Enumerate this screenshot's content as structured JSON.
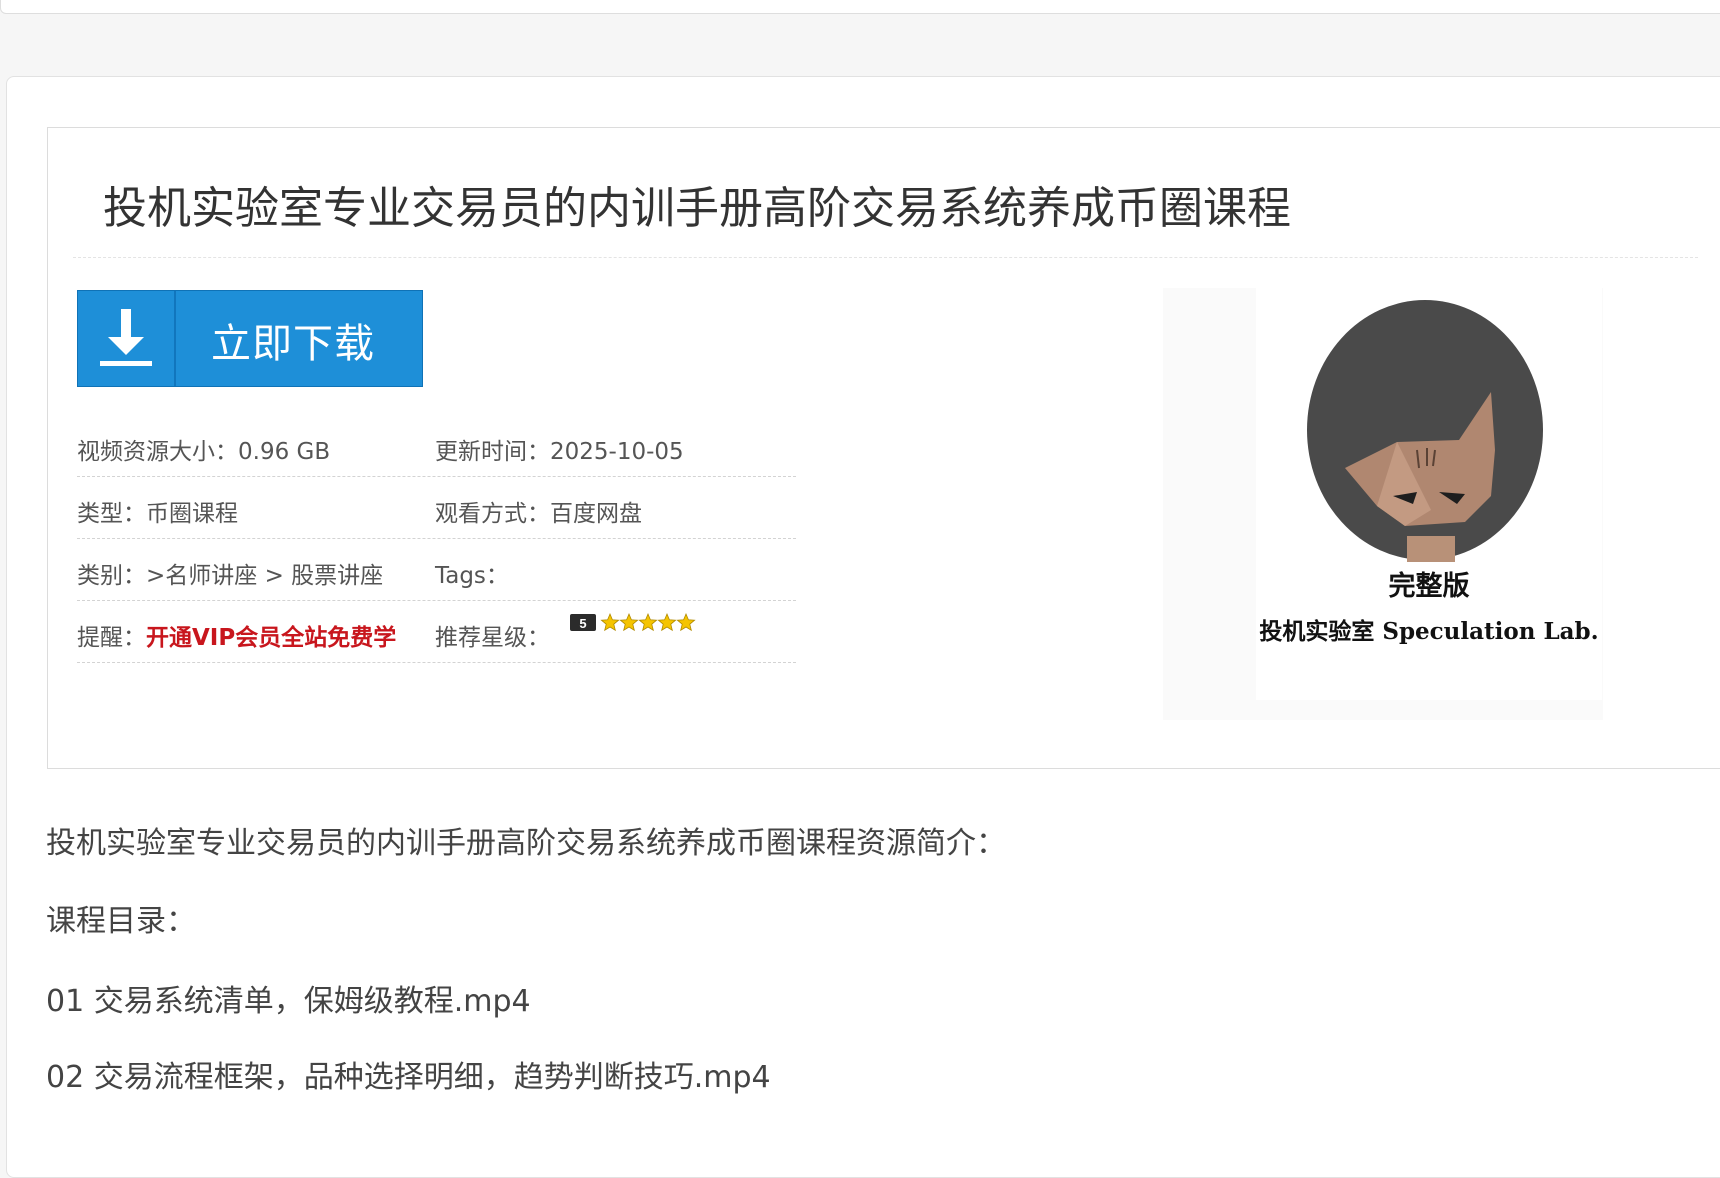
{
  "page_title": "投机实验室专业交易员的内训手册高阶交易系统养成币圈课程",
  "download_button": {
    "label": "立即下载",
    "icon": "download-arrow-icon"
  },
  "meta": {
    "size": "视频资源大小：0.96 GB",
    "updated": "更新时间：2025-10-05",
    "type": "类型：币圈课程",
    "watch": "观看方式：百度网盘",
    "category": "类别：>名师讲座 > 股票讲座",
    "tags": "Tags：",
    "reminder_label": "提醒：",
    "reminder_link": "开通VIP会员全站免费学",
    "rating_label": "推荐星级：",
    "rating_badge": "5",
    "rating_stars": 5
  },
  "cover": {
    "line1": "完整版",
    "line2": "投机实验室  Speculation  Lab."
  },
  "description": {
    "intro": "投机实验室专业交易员的内训手册高阶交易系统养成币圈课程资源简介：",
    "toc_heading": " 课程目录：",
    "items": [
      "01 交易系统清单，保姆级教程.mp4",
      "02 交易流程框架，品种选择明细，趋势判断技巧.mp4"
    ]
  },
  "colors": {
    "download_bg": "#1e8fd8",
    "vip_text": "#c8161d",
    "star": "#f5c400"
  }
}
